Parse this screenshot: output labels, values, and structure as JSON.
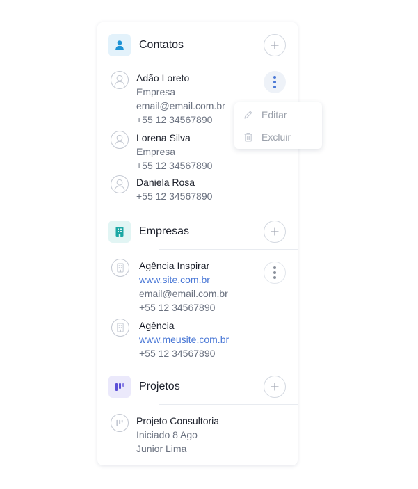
{
  "colors": {
    "contacts_accent": "#1e93d6",
    "contacts_bg": "#e3f2fb",
    "companies_accent": "#1ca7a4",
    "companies_bg": "#e2f5f4",
    "projects_accent": "#5b4fd6",
    "projects_bg": "#ebe9fb",
    "link": "#4a78d6"
  },
  "contacts": {
    "title": "Contatos",
    "icon": "person-icon",
    "add_label": "+",
    "items": [
      {
        "name": "Adão Loreto",
        "company": "Empresa",
        "email": "email@email.com.br",
        "phone": "+55 12 34567890"
      },
      {
        "name": "Lorena Silva",
        "company": "Empresa",
        "phone": "+55 12 34567890"
      },
      {
        "name": "Daniela Rosa",
        "phone": "+55 12 34567890"
      }
    ]
  },
  "menu": {
    "edit_label": "Editar",
    "delete_label": "Excluir"
  },
  "companies": {
    "title": "Empresas",
    "icon": "building-icon",
    "add_label": "+",
    "items": [
      {
        "name": "Agência Inspirar",
        "site": "www.site.com.br",
        "email": "email@email.com.br",
        "phone": "+55 12 34567890"
      },
      {
        "name": "Agência",
        "site": "www.meusite.com.br",
        "phone": "+55 12 34567890"
      }
    ]
  },
  "projects": {
    "title": "Projetos",
    "icon": "project-icon",
    "add_label": "+",
    "items": [
      {
        "name": "Projeto Consultoria",
        "started": "Iniciado 8 Ago",
        "owner": "Junior Lima"
      }
    ]
  }
}
